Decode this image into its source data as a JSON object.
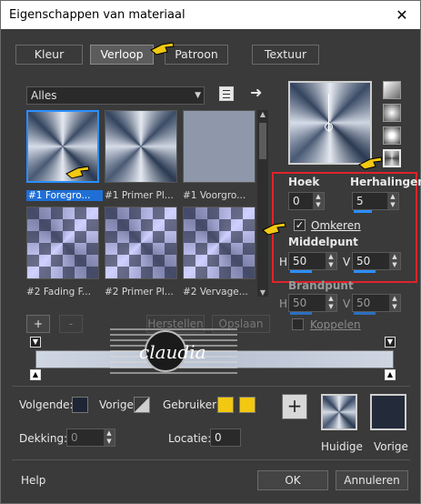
{
  "window": {
    "title": "Eigenschappen van materiaal",
    "close_glyph": "✕"
  },
  "tabs": [
    {
      "label": "Kleur",
      "active": false
    },
    {
      "label": "Verloop",
      "active": true
    },
    {
      "label": "Patroon",
      "active": false
    },
    {
      "label": "Textuur",
      "active": false
    }
  ],
  "gallery": {
    "filter_value": "Alles",
    "thumbnails": [
      {
        "caption": "#1 Foregro...",
        "style": "conic",
        "selected": true
      },
      {
        "caption": "#1 Primer Pl...",
        "style": "conic",
        "selected": false
      },
      {
        "caption": "#1 Voorgro...",
        "style": "flat",
        "selected": false
      },
      {
        "caption": "#2 Fading F...",
        "style": "check",
        "selected": false
      },
      {
        "caption": "#2 Primer Pl...",
        "style": "check",
        "selected": false
      },
      {
        "caption": "#2 Vervage...",
        "style": "check",
        "selected": false
      }
    ],
    "add_label": "+",
    "remove_label": "-",
    "restore_label": "Herstellen",
    "save_label": "Opslaan"
  },
  "settings": {
    "angle_label": "Hoek",
    "angle_value": "0",
    "repeats_label": "Herhalingen",
    "repeats_value": "5",
    "invert_label": "Omkeren",
    "invert_checked": true,
    "center_label": "Middelpunt",
    "center_h_label": "H",
    "center_h_value": "50",
    "center_v_label": "V",
    "center_v_value": "50",
    "focal_label": "Brandpunt",
    "focal_h_label": "H",
    "focal_h_value": "50",
    "focal_v_label": "V",
    "focal_v_value": "50",
    "link_label": "Koppelen",
    "link_checked": false
  },
  "editor": {
    "foreground_label": "Volgende:",
    "previous_label": "Vorige:",
    "user_label": "Gebruiker:",
    "opacity_label": "Dekking:",
    "opacity_value": "0",
    "location_label": "Locatie:",
    "location_value": "0",
    "user_color": "#f2c811",
    "foreground_color": "#1e2535"
  },
  "result": {
    "add_glyph": "+",
    "current_label": "Huidige",
    "previous_label": "Vorige",
    "previous_color": "#232b3b"
  },
  "footer": {
    "help_label": "Help",
    "ok_label": "OK",
    "cancel_label": "Annuleren"
  },
  "icons": {
    "list_view": "list-view-icon",
    "arrow_right": "arrow-right-icon",
    "hand_pointer": "hand-pointer-icon"
  },
  "watermark": {
    "text": "claudia"
  },
  "colors": {
    "accent": "#2b8fff",
    "highlight": "#e0232a",
    "pointer": "#f2c811"
  }
}
